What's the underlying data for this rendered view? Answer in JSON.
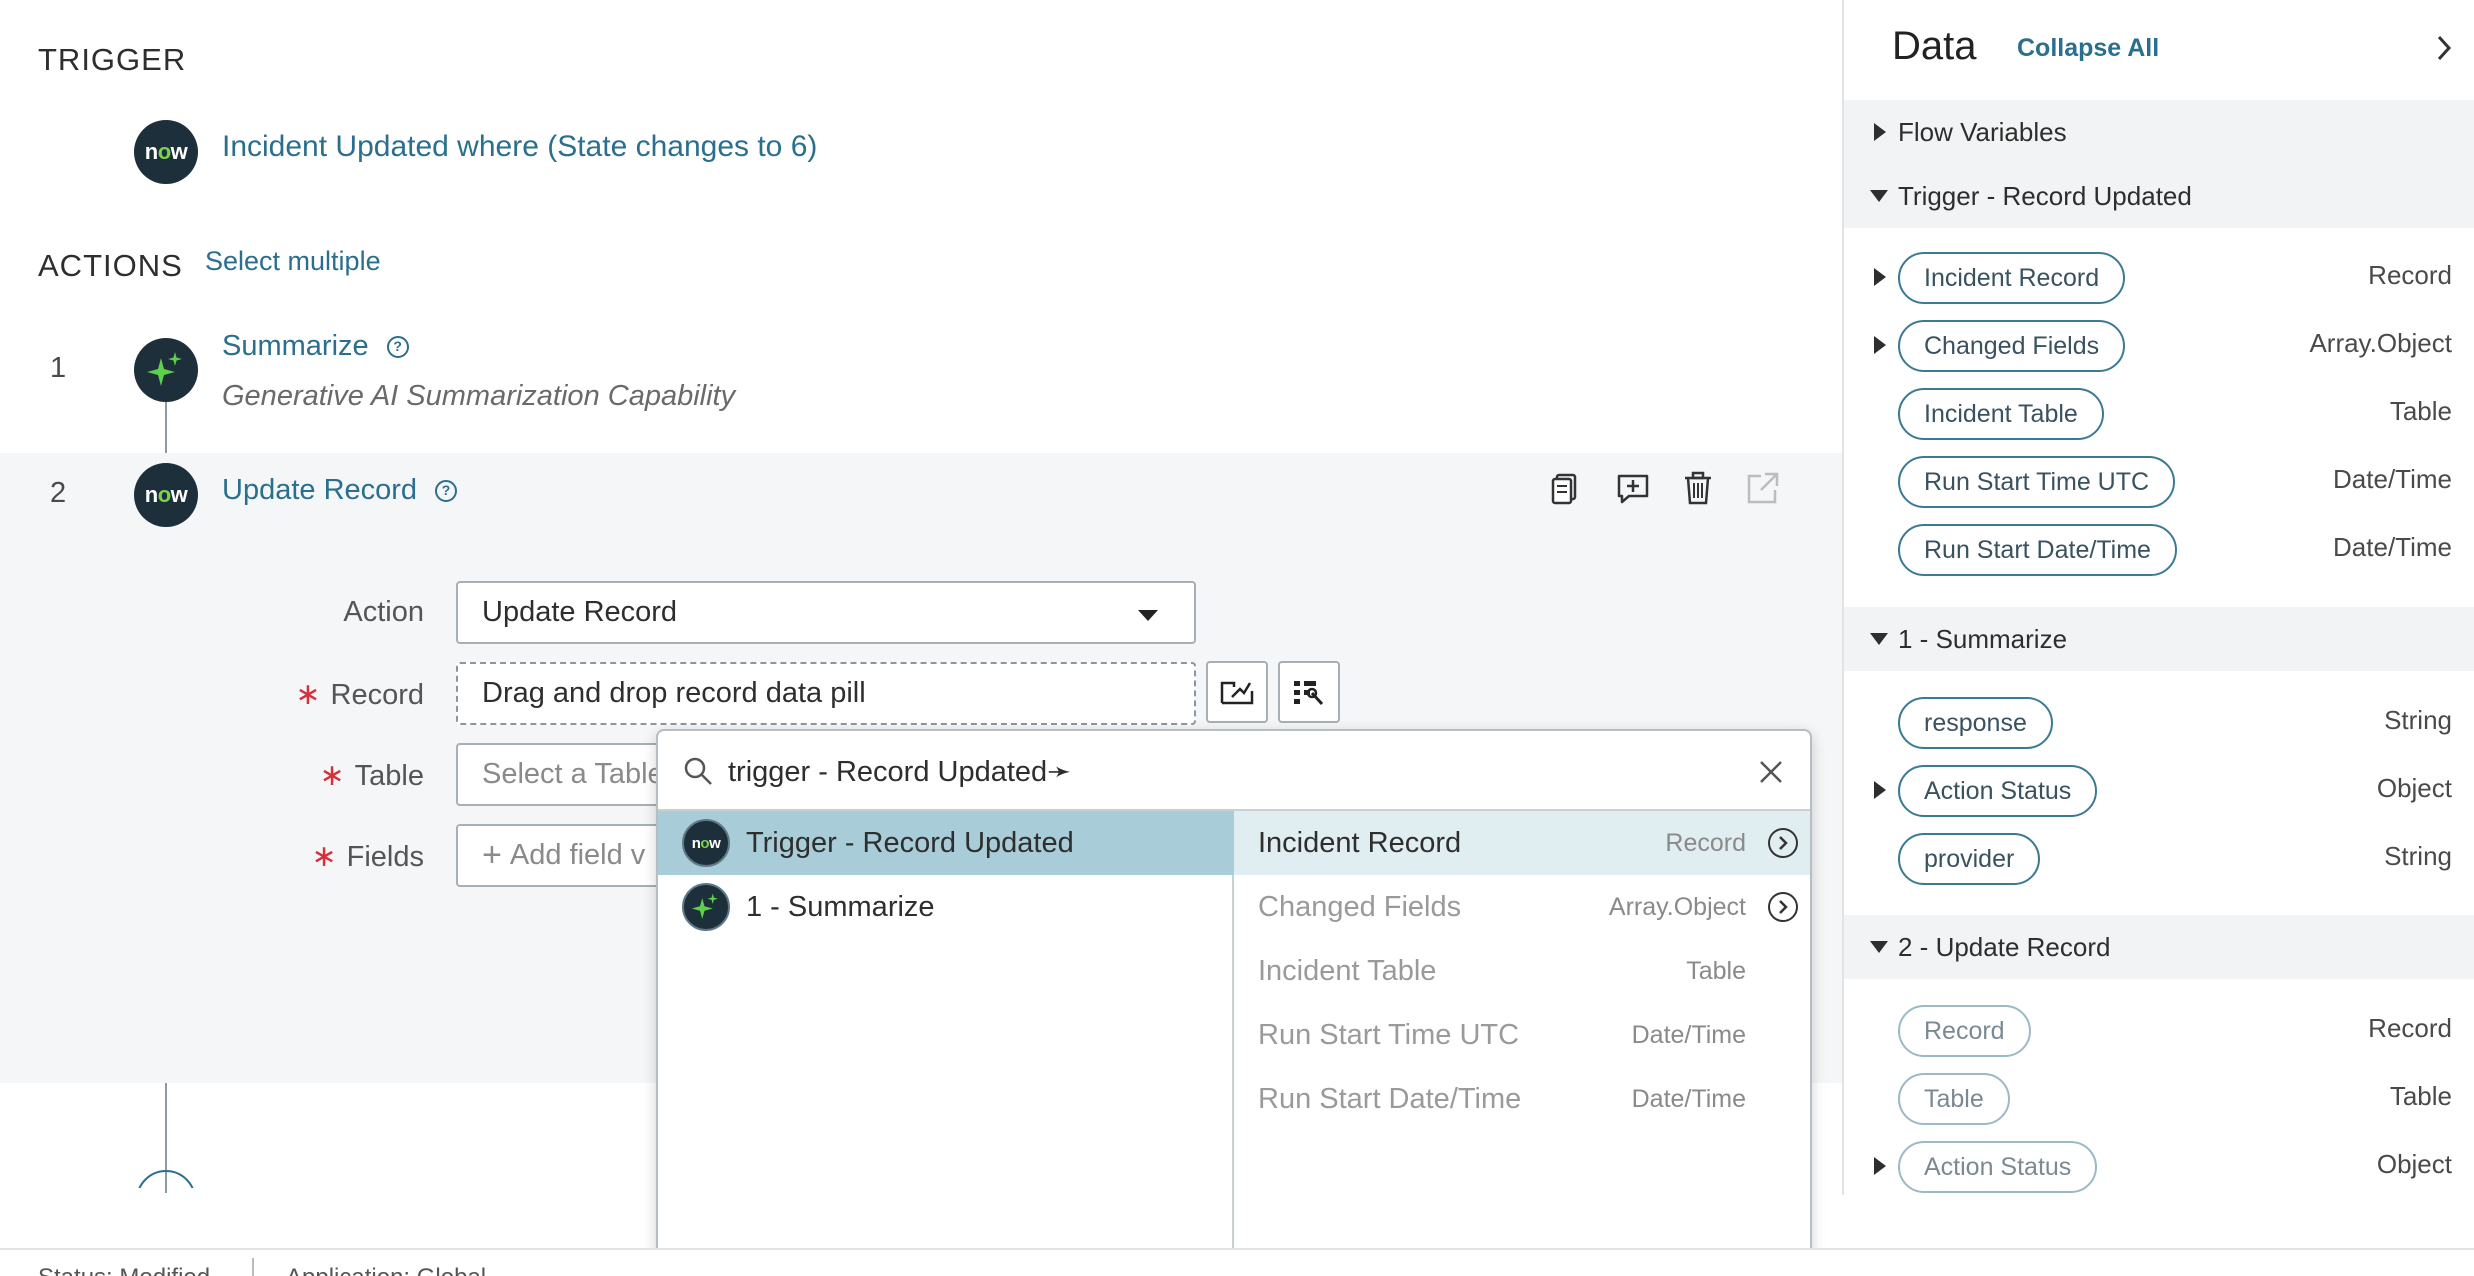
{
  "trigger": {
    "section_title": "TRIGGER",
    "description": "Incident Updated where (State changes to 6)"
  },
  "actions": {
    "section_title": "ACTIONS",
    "select_multiple": "Select multiple",
    "steps": [
      {
        "number": "1",
        "title": "Summarize",
        "subtitle": "Generative AI Summarization Capability"
      },
      {
        "number": "2",
        "title": "Update Record"
      }
    ]
  },
  "form": {
    "action_label": "Action",
    "action_value": "Update Record",
    "record_label": "Record",
    "record_value": "Drag and drop record data pill",
    "table_label": "Table",
    "table_placeholder": "Select a Table",
    "fields_label": "Fields",
    "fields_placeholder": "Add field v",
    "required_mark": "∗"
  },
  "picker": {
    "search_value": "trigger - Record Updated➛",
    "sources": [
      {
        "label": "Trigger - Record Updated",
        "icon": "now-logo-icon",
        "selected": true
      },
      {
        "label": "1 - Summarize",
        "icon": "ai-sparkle-icon",
        "selected": false
      }
    ],
    "items": [
      {
        "name": "Incident Record",
        "type": "Record",
        "expandable": true,
        "enabled": true
      },
      {
        "name": "Changed Fields",
        "type": "Array.Object",
        "expandable": true,
        "enabled": false
      },
      {
        "name": "Incident Table",
        "type": "Table",
        "expandable": false,
        "enabled": false
      },
      {
        "name": "Run Start Time UTC",
        "type": "Date/Time",
        "expandable": false,
        "enabled": false
      },
      {
        "name": "Run Start Date/Time",
        "type": "Date/Time",
        "expandable": false,
        "enabled": false
      }
    ]
  },
  "data_panel": {
    "title": "Data",
    "collapse_all": "Collapse All",
    "flow_variables": "Flow Variables",
    "trigger_section": "Trigger - Record Updated",
    "trigger_rows": [
      {
        "pill": "Incident Record",
        "type": "Record",
        "expandable": true
      },
      {
        "pill": "Changed Fields",
        "type": "Array.Object",
        "expandable": true
      },
      {
        "pill": "Incident Table",
        "type": "Table",
        "expandable": false
      },
      {
        "pill": "Run Start Time UTC",
        "type": "Date/Time",
        "expandable": false
      },
      {
        "pill": "Run Start Date/Time",
        "type": "Date/Time",
        "expandable": false
      }
    ],
    "summarize_section": "1 - Summarize",
    "summarize_rows": [
      {
        "pill": "response",
        "type": "String",
        "expandable": false
      },
      {
        "pill": "Action Status",
        "type": "Object",
        "expandable": true
      },
      {
        "pill": "provider",
        "type": "String",
        "expandable": false
      }
    ],
    "update_section": "2 - Update Record",
    "update_rows": [
      {
        "pill": "Record",
        "type": "Record",
        "expandable": false
      },
      {
        "pill": "Table",
        "type": "Table",
        "expandable": false
      },
      {
        "pill": "Action Status",
        "type": "Object",
        "expandable": true
      }
    ]
  },
  "status_bar": {
    "status": "Status: Modified",
    "application": "Application: Global"
  },
  "colors": {
    "link": "#2a6f8e",
    "badge_bg": "#1d2f3a",
    "selected_source": "#a9cdd8",
    "selected_item": "#e0edf1",
    "required": "#d6303a"
  }
}
